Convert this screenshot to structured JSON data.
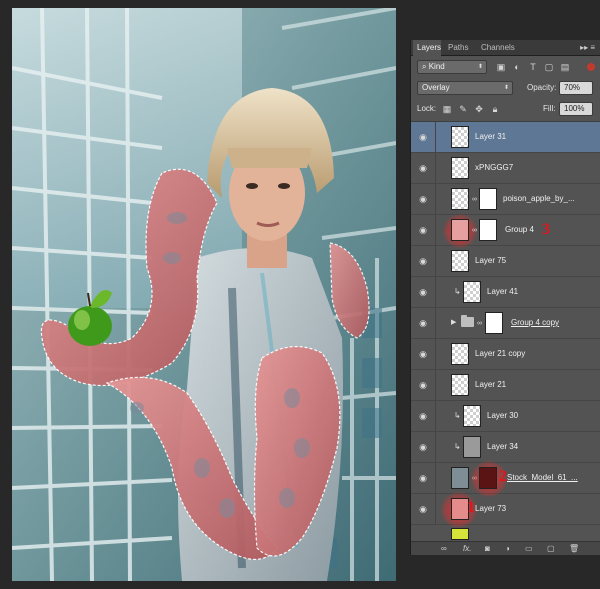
{
  "panel": {
    "tabs": [
      {
        "label": "Layers",
        "active": true
      },
      {
        "label": "Paths",
        "active": false
      },
      {
        "label": "Channels",
        "active": false
      }
    ],
    "menu_icon": "panel-menu-icon",
    "kind_filter": "Kind",
    "kind_icons": [
      "pixel-filter-icon",
      "adjustment-filter-icon",
      "type-filter-icon",
      "shape-filter-icon",
      "smart-object-filter-icon"
    ],
    "blend_mode": "Overlay",
    "opacity_label": "Opacity:",
    "opacity_value": "70%",
    "lock_label": "Lock:",
    "fill_label": "Fill:",
    "fill_value": "100%",
    "lock_icons": [
      "lock-transparent-icon",
      "lock-image-icon",
      "lock-position-icon",
      "lock-all-icon"
    ],
    "layers": [
      {
        "name": "Layer 31",
        "selected": true
      },
      {
        "name": "xPNGGG7"
      },
      {
        "name": "poison_apple_by_..."
      },
      {
        "name": "Group 4",
        "annotation": "3"
      },
      {
        "name": "Layer 75"
      },
      {
        "name": "Layer 41"
      },
      {
        "name": "Group 4 copy"
      },
      {
        "name": "Layer 21 copy"
      },
      {
        "name": "Layer 21"
      },
      {
        "name": "Layer 30"
      },
      {
        "name": "Layer 34"
      },
      {
        "name": "Stock_Model_61_...",
        "annotation": "2"
      },
      {
        "name": "Layer 73",
        "annotation": "1"
      }
    ],
    "footer_icons": [
      "link-layers-icon",
      "fx-icon",
      "add-mask-icon",
      "adjustment-layer-icon",
      "new-group-icon",
      "new-layer-icon",
      "delete-layer-icon"
    ],
    "footer_fx": "fx."
  },
  "colors": {
    "selected_layer": "#5e7794",
    "annotation": "#e3141b",
    "panel_bg": "#535353"
  }
}
